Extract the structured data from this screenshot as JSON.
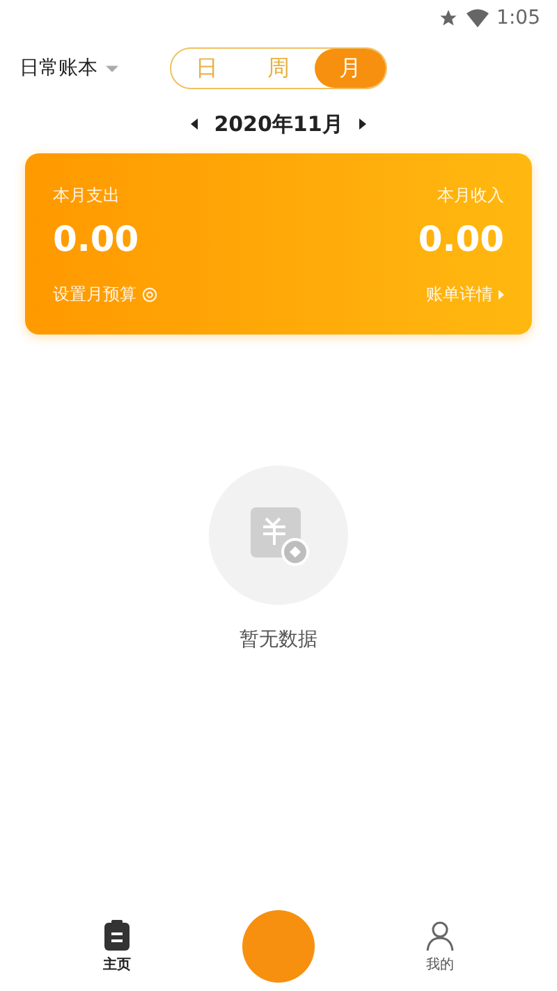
{
  "status_bar": {
    "time": "1:05"
  },
  "header": {
    "book": "日常账本",
    "periods": [
      {
        "label": "日",
        "selected": false
      },
      {
        "label": "周",
        "selected": false
      },
      {
        "label": "月",
        "selected": true
      }
    ]
  },
  "month": "2020年11月",
  "summary": {
    "expense_label": "本月支出",
    "expense": "0.00",
    "income_label": "本月收入",
    "income": "0.00",
    "budget_link": "设置月预算",
    "details_link": "账单详情"
  },
  "empty": {
    "text": "暂无数据"
  },
  "tabs": [
    {
      "label": "主页",
      "kind": "home",
      "selected": true
    },
    {
      "kind": "add",
      "selected": false
    },
    {
      "label": "我的",
      "kind": "profile",
      "selected": false
    }
  ]
}
